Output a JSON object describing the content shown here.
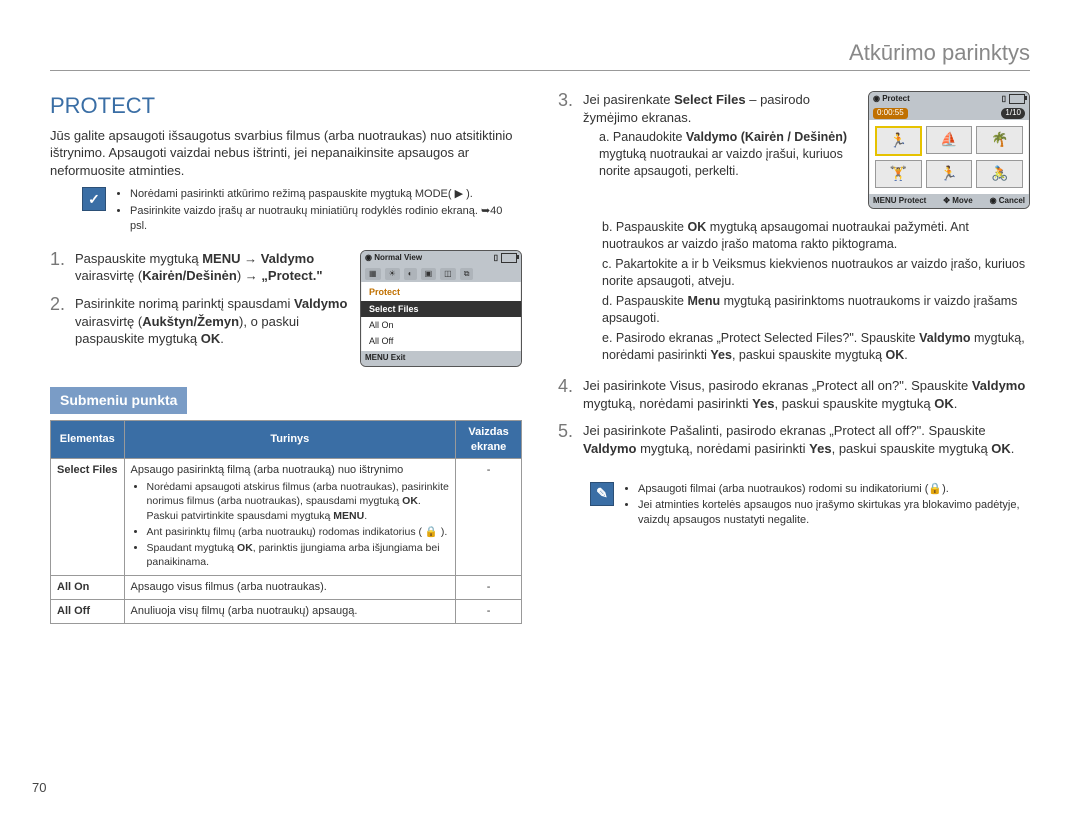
{
  "page": {
    "breadcrumb": "Atkūrimo parinktys",
    "number": "70"
  },
  "heading": "PROTECT",
  "intro": "Jūs galite apsaugoti išsaugotus svarbius filmus (arba nuotraukas) nuo atsitiktinio ištrynimo. Apsaugoti vaizdai nebus ištrinti, jei nepanaikinsite apsaugos ar neformuosite atminties.",
  "callout1": {
    "items": [
      "Norėdami pasirinkti atkūrimo režimą paspauskite mygtuką MODE( ▶ ).",
      "Pasirinkite vaizdo įrašų ar nuotraukų miniatiūrų rodyklės rodinio ekraną. ➥40 psl."
    ]
  },
  "step1": {
    "num": "1.",
    "text_before": "Paspauskite mygtuką ",
    "menu": "MENU",
    "arrow1": " → ",
    "valdymo": "Valdymo",
    "vairasvirte": " vairasvirtę (",
    "dirs": "Kairėn/Dešinėn",
    "arrow2": ") → ",
    "protect": "„Protect.\""
  },
  "step2": {
    "num": "2.",
    "text": "Pasirinkite norimą parinktį spausdami Valdymo vairasvirtę (Aukštyn/Žemyn), o paskui paspauskite mygtuką OK."
  },
  "lcd_menu": {
    "title": "Normal View",
    "protect_label": "Protect",
    "items": [
      "Select Files",
      "All On",
      "All Off"
    ],
    "footer_left": "MENU Exit"
  },
  "subheading": "Submeniu punkta",
  "table": {
    "headers": [
      "Elementas",
      "Turinys",
      "Vaizdas ekrane"
    ],
    "rows": [
      {
        "elem": "Select Files",
        "desc_lead": "Apsaugo pasirinktą filmą (arba nuotrauką) nuo ištrynimo",
        "bullets": [
          "Norėdami apsaugoti atskirus filmus (arba nuotraukas), pasirinkite norimus filmus (arba nuotraukas), spausdami mygtuką OK. Paskui patvirtinkite spausdami mygtuką MENU.",
          "Ant pasirinktų filmų (arba nuotraukų) rodomas indikatorius ( 🔒 ).",
          "Spaudant mygtuką OK, parinktis įjungiama arba išjungiama bei panaikinama."
        ],
        "screen": "-"
      },
      {
        "elem": "All On",
        "desc_lead": "Apsaugo visus filmus (arba nuotraukas).",
        "bullets": [],
        "screen": "-"
      },
      {
        "elem": "All Off",
        "desc_lead": "Anuliuoja visų filmų (arba nuotraukų) apsaugą.",
        "bullets": [],
        "screen": "-"
      }
    ]
  },
  "colR": {
    "step3": {
      "num": "3.",
      "lead": "Jei pasirenkate Select Files – pasirodo žymėjimo ekranas.",
      "a": "a. Panaudokite Valdymo (Kairėn / Dešinėn) mygtuką nuotraukai ar vaizdo įrašui, kuriuos norite apsaugoti, perkelti.",
      "b": "b. Paspauskite OK mygtuką apsaugomai nuotraukai pažymėti. Ant nuotraukos ar vaizdo įrašo matoma rakto piktograma.",
      "c": "c. Pakartokite a ir b Veiksmus kiekvienos nuotraukos ar vaizdo įrašo, kuriuos norite apsaugoti, atveju.",
      "d": "d. Paspauskite Menu mygtuką pasirinktoms nuotraukoms ir vaizdo įrašams apsaugoti.",
      "e": "e. Pasirodo ekranas „Protect Selected Files?\". Spauskite Valdymo mygtuką, norėdami pasirinkti Yes, paskui spauskite mygtuką OK."
    },
    "step4": {
      "num": "4.",
      "text": "Jei pasirinkote Visus, pasirodo ekranas „Protect all on?\". Spauskite Valdymo mygtuką, norėdami pasirinkti Yes, paskui spauskite mygtuką OK."
    },
    "step5": {
      "num": "5.",
      "text": "Jei pasirinkote Pašalinti, pasirodo ekranas „Protect all off?\". Spauskite Valdymo mygtuką, norėdami pasirinkti Yes, paskui spauskite mygtuką OK."
    }
  },
  "lcd_thumbs": {
    "title": "Protect",
    "time": "0:00:55",
    "count": "1/10",
    "footer": {
      "left": "MENU Protect",
      "mid": "✥ Move",
      "right": "◉ Cancel"
    }
  },
  "callout2": {
    "items": [
      "Apsaugoti filmai (arba nuotraukos) rodomi su indikatoriumi (🔒).",
      "Jei atminties kortelės apsaugos nuo įrašymo skirtukas yra blokavimo padėtyje, vaizdų apsaugos nustatyti negalite."
    ]
  }
}
